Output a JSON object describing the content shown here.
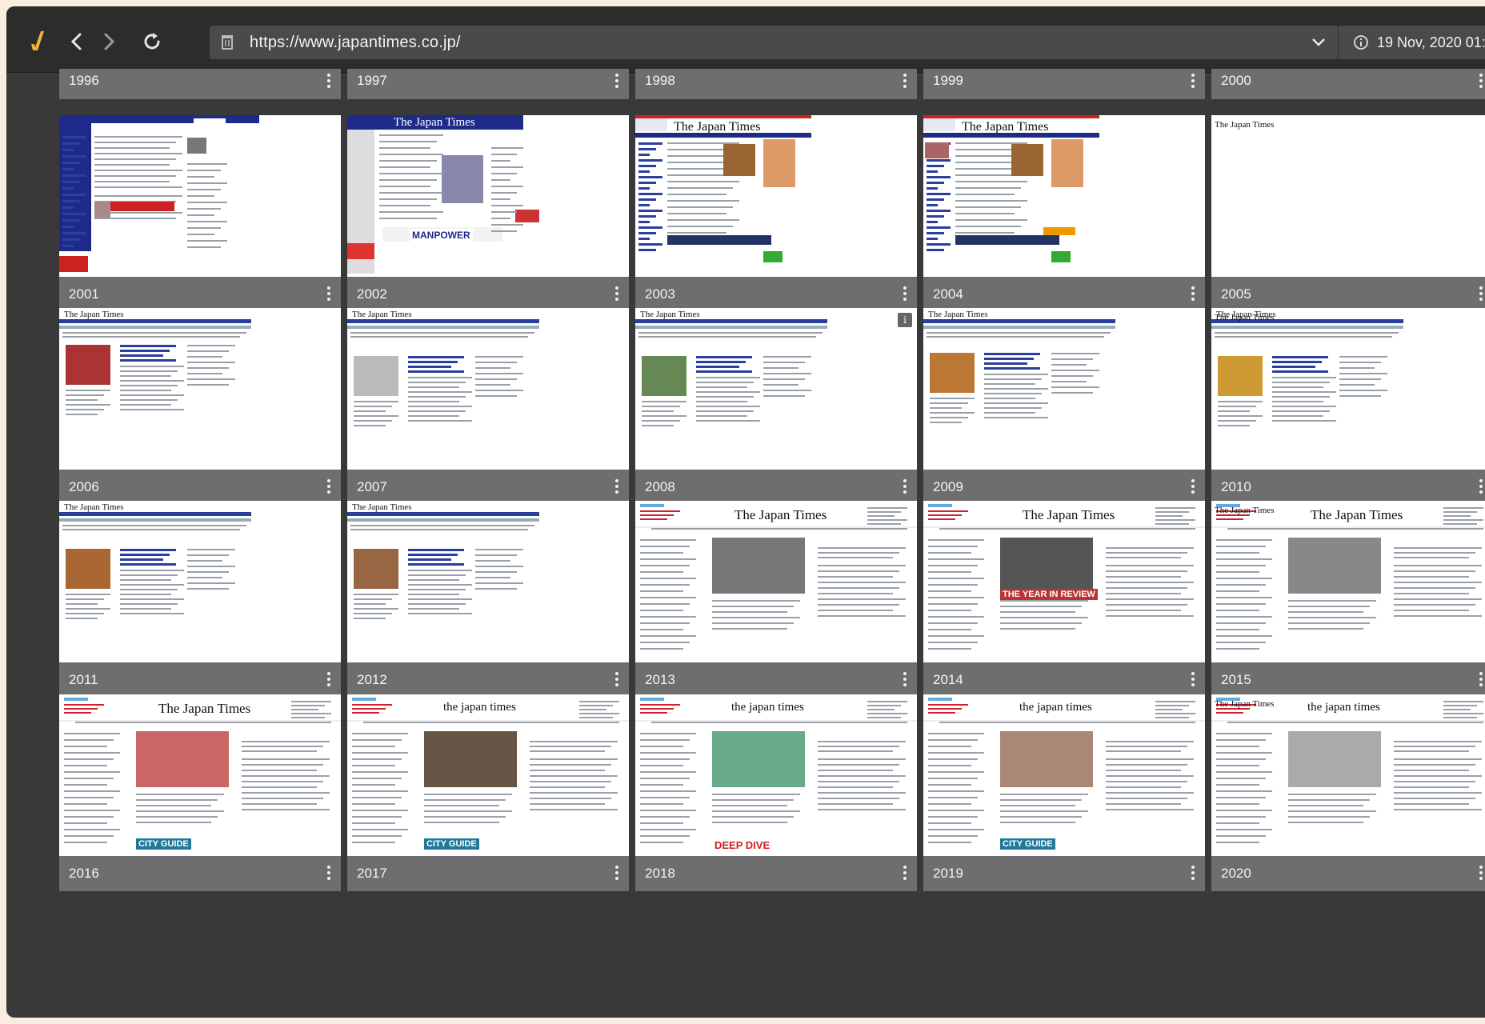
{
  "browser": {
    "url": "https://www.japantimes.co.jp/",
    "capture_date": "19 Nov, 2020 01:4"
  },
  "colors": {
    "window_bg": "#393939",
    "toolbar_bg": "#2c2c2c",
    "caption_bg": "#6e6e6e",
    "accent_logo": "#e8b53a"
  },
  "header_row": [
    "1996",
    "1997",
    "1998",
    "1999",
    "2000"
  ],
  "rows": [
    [
      "2001",
      "2002",
      "2003",
      "2004",
      "2005"
    ],
    [
      "2006",
      "2007",
      "2008",
      "2009",
      "2010"
    ],
    [
      "2011",
      "2012",
      "2013",
      "2014",
      "2015"
    ],
    [
      "2016",
      "2017",
      "2018",
      "2019",
      "2020"
    ]
  ],
  "thumb_text": {
    "masthead_serif": "The Japan Times",
    "masthead_lower": "the japan times",
    "manpower": "MANPOWER",
    "city_guide": "CITY GUIDE",
    "deep_dive": "DEEP DIVE",
    "year_review": "THE YEAR IN REVIEW",
    "info_glyph": "i"
  }
}
